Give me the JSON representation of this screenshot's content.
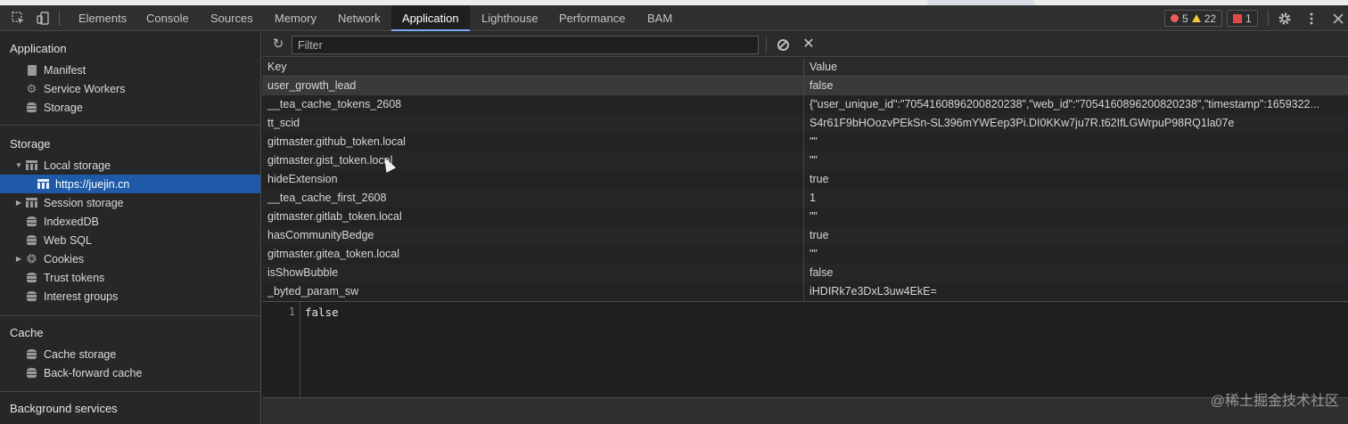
{
  "tabbar": {
    "tabs": [
      "Elements",
      "Console",
      "Sources",
      "Memory",
      "Network",
      "Application",
      "Lighthouse",
      "Performance",
      "BAM"
    ],
    "active": "Application",
    "errors": "5",
    "warnings": "22",
    "issues": "1"
  },
  "sidebar": {
    "application_heading": "Application",
    "application_items": [
      "Manifest",
      "Service Workers",
      "Storage"
    ],
    "storage_heading": "Storage",
    "storage_items": [
      "Local storage",
      "https://juejin.cn",
      "Session storage",
      "IndexedDB",
      "Web SQL",
      "Cookies",
      "Trust tokens",
      "Interest groups"
    ],
    "cache_heading": "Cache",
    "cache_items": [
      "Cache storage",
      "Back-forward cache"
    ],
    "background_heading": "Background services"
  },
  "toolbar": {
    "filter_placeholder": "Filter"
  },
  "table": {
    "headers": {
      "key": "Key",
      "value": "Value"
    },
    "rows": [
      {
        "key": "user_growth_lead",
        "value": "false"
      },
      {
        "key": "__tea_cache_tokens_2608",
        "value": "{\"user_unique_id\":\"7054160896200820238\",\"web_id\":\"7054160896200820238\",\"timestamp\":1659322..."
      },
      {
        "key": "tt_scid",
        "value": "S4r61F9bHOozvPEkSn-SL396mYWEep3Pi.DI0KKw7ju7R.t62IfLGWrpuP98RQ1la07e"
      },
      {
        "key": "gitmaster.github_token.local",
        "value": "\"\""
      },
      {
        "key": "gitmaster.gist_token.local",
        "value": "\"\""
      },
      {
        "key": "hideExtension",
        "value": "true"
      },
      {
        "key": "__tea_cache_first_2608",
        "value": "1"
      },
      {
        "key": "gitmaster.gitlab_token.local",
        "value": "\"\""
      },
      {
        "key": "hasCommunityBedge",
        "value": "true"
      },
      {
        "key": "gitmaster.gitea_token.local",
        "value": "\"\""
      },
      {
        "key": "isShowBubble",
        "value": "false"
      },
      {
        "key": "_byted_param_sw",
        "value": "iHDIRk7e3DxL3uw4EkE="
      }
    ]
  },
  "preview": {
    "line_number": "1",
    "content": "false"
  },
  "watermark": "@稀土掘金技术社区"
}
